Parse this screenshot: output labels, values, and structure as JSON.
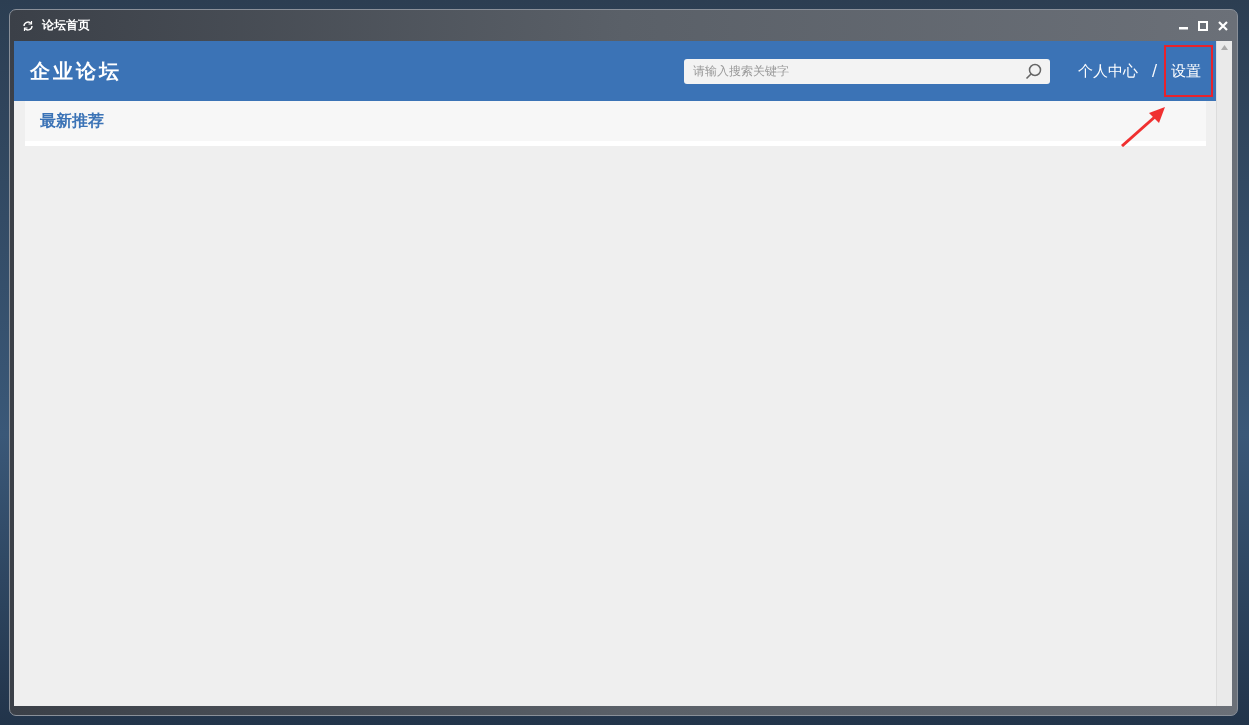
{
  "window": {
    "title": "论坛首页"
  },
  "header": {
    "title": "企业论坛",
    "search": {
      "placeholder": "请输入搜索关键字"
    },
    "links": [
      {
        "label": "个人中心",
        "highlighted": false
      },
      {
        "label": "设置",
        "highlighted": true
      }
    ],
    "separator": "/"
  },
  "section": {
    "title": "最新推荐"
  }
}
